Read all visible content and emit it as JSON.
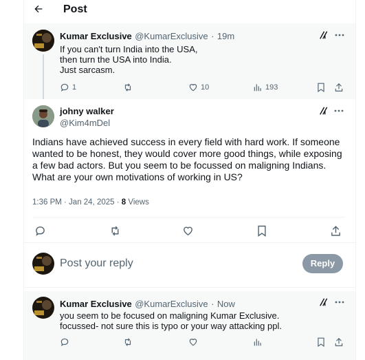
{
  "header": {
    "title": "Post"
  },
  "parent_post": {
    "display_name": "Kumar Exclusive",
    "handle": "@KumarExclusive",
    "time": "19m",
    "text": "If you can't turn India into the USA,\nthen turn the USA into India.\n Just sarcasm.",
    "replies": "1",
    "likes": "10",
    "views": "193"
  },
  "main_post": {
    "display_name": "johny walker",
    "handle": "@Kim4mDel",
    "text": "Indians have achieved success in every field with hard work. If someone wanted to be honest, they would cover more good things, while exposing a few bad actors. But you seem to be focussed on maligning Indians. What are your own motivations of working in US?",
    "timestamp": "1:36 PM · Jan 24, 2025 · ",
    "views_count": "8",
    "views_label": " Views"
  },
  "composer": {
    "placeholder": "Post your reply",
    "reply_button": "Reply"
  },
  "reply_post": {
    "display_name": "Kumar Exclusive",
    "handle": "@KumarExclusive",
    "time": "Now",
    "text": "you seem to be focused on maligning Kumar Exclusive.\nfocussed- not sure this is typo or your way attacking ppl."
  },
  "icons": {
    "back": "arrow-left-icon",
    "grok": "grok-icon",
    "more": "more-icon",
    "reply": "reply-icon",
    "repost": "repost-icon",
    "like": "like-icon",
    "views": "views-icon",
    "bookmark": "bookmark-icon",
    "share": "share-icon"
  },
  "colors": {
    "accent": "#1d9bf0",
    "reply_button_bg": "#8b98a5",
    "highlight_bg": "#f7f9f9"
  }
}
